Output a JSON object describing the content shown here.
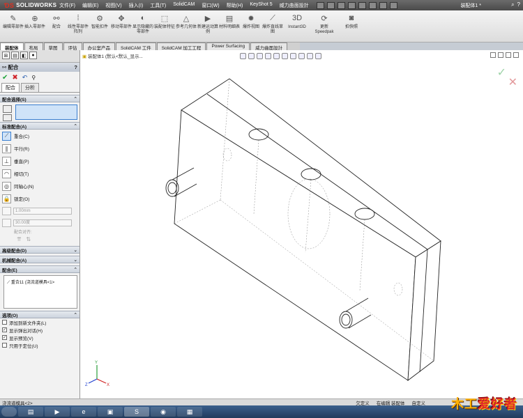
{
  "app": {
    "logo": "SOLIDWORKS",
    "doc_title": "装配体1 *"
  },
  "menu": [
    "文件(F)",
    "编辑(E)",
    "视图(V)",
    "插入(I)",
    "工具(T)",
    "SolidCAM",
    "窗口(W)",
    "帮助(H)",
    "KeyShot 5",
    "威力曲面設計"
  ],
  "cmd_buttons": [
    {
      "label": "编辑零部件",
      "icon": "edit-component-icon"
    },
    {
      "label": "插入零部件",
      "icon": "insert-component-icon"
    },
    {
      "label": "配合",
      "icon": "mate-icon"
    },
    {
      "label": "线性零部件阵列",
      "icon": "linear-pattern-icon"
    },
    {
      "label": "智能扣件",
      "icon": "smart-fastener-icon"
    },
    {
      "label": "移动零部件",
      "icon": "move-component-icon"
    },
    {
      "label": "显示隐藏的零部件",
      "icon": "show-hidden-icon"
    },
    {
      "label": "装配体特征",
      "icon": "assembly-feature-icon"
    },
    {
      "label": "参考几何体",
      "icon": "reference-geometry-icon"
    },
    {
      "label": "新建运动算例",
      "icon": "motion-study-icon"
    },
    {
      "label": "材料明细表",
      "icon": "bom-icon"
    },
    {
      "label": "爆炸视图",
      "icon": "exploded-view-icon"
    },
    {
      "label": "爆炸直线草图",
      "icon": "explode-line-icon"
    },
    {
      "label": "Instant3D",
      "icon": "instant3d-icon"
    },
    {
      "label": "更新Speedpak",
      "icon": "speedpak-icon"
    },
    {
      "label": "拍快照",
      "icon": "snapshot-icon"
    }
  ],
  "tabs": [
    "装配体",
    "布局",
    "草图",
    "评估",
    "办公室产品",
    "SolidCAM 工件",
    "SolidCAM 加工工程",
    "Power Surfacing",
    "威力曲面設計"
  ],
  "property_manager": {
    "title": "配合",
    "help": "?",
    "subtabs": [
      "配合",
      "分析"
    ],
    "selections_header": "配合选择(S)",
    "standard_header": "标准配合(A)",
    "standard_mates": [
      {
        "label": "重合(C)",
        "icon": "coincident-icon",
        "glyph": "⟋"
      },
      {
        "label": "平行(R)",
        "icon": "parallel-icon",
        "glyph": "∥"
      },
      {
        "label": "垂直(P)",
        "icon": "perpendicular-icon",
        "glyph": "⊥"
      },
      {
        "label": "相切(T)",
        "icon": "tangent-icon",
        "glyph": "◠"
      },
      {
        "label": "同轴心(N)",
        "icon": "concentric-icon",
        "glyph": "◎"
      },
      {
        "label": "锁定(O)",
        "icon": "lock-icon",
        "glyph": "🔒"
      }
    ],
    "distance_value": "1.00mm",
    "angle_value": "30.00度",
    "alignment_label": "配合对齐:",
    "advanced_header": "高级配合(D)",
    "mechanical_header": "机械配合(A)",
    "mates_header": "配合(E)",
    "mates_list": [
      "重合11 (浇流道模具<1>"
    ],
    "options_header": "选项(O)",
    "options": [
      {
        "label": "添加到新文件夹(L)",
        "checked": false
      },
      {
        "label": "显示弹出对话(H)",
        "checked": true
      },
      {
        "label": "显示预览(V)",
        "checked": true
      },
      {
        "label": "只用于定位(U)",
        "checked": false
      }
    ]
  },
  "graphics": {
    "crumb": "装配体1  (默认<默认_显示...",
    "ok_mark": "✓",
    "cancel_mark": "✕"
  },
  "status": {
    "left": "浇流道模具<2>",
    "right": [
      "欠定义",
      "在编辑 装配体",
      "自定义"
    ]
  },
  "brand": {
    "prefix": "木工",
    "suffix": "爱好者"
  }
}
